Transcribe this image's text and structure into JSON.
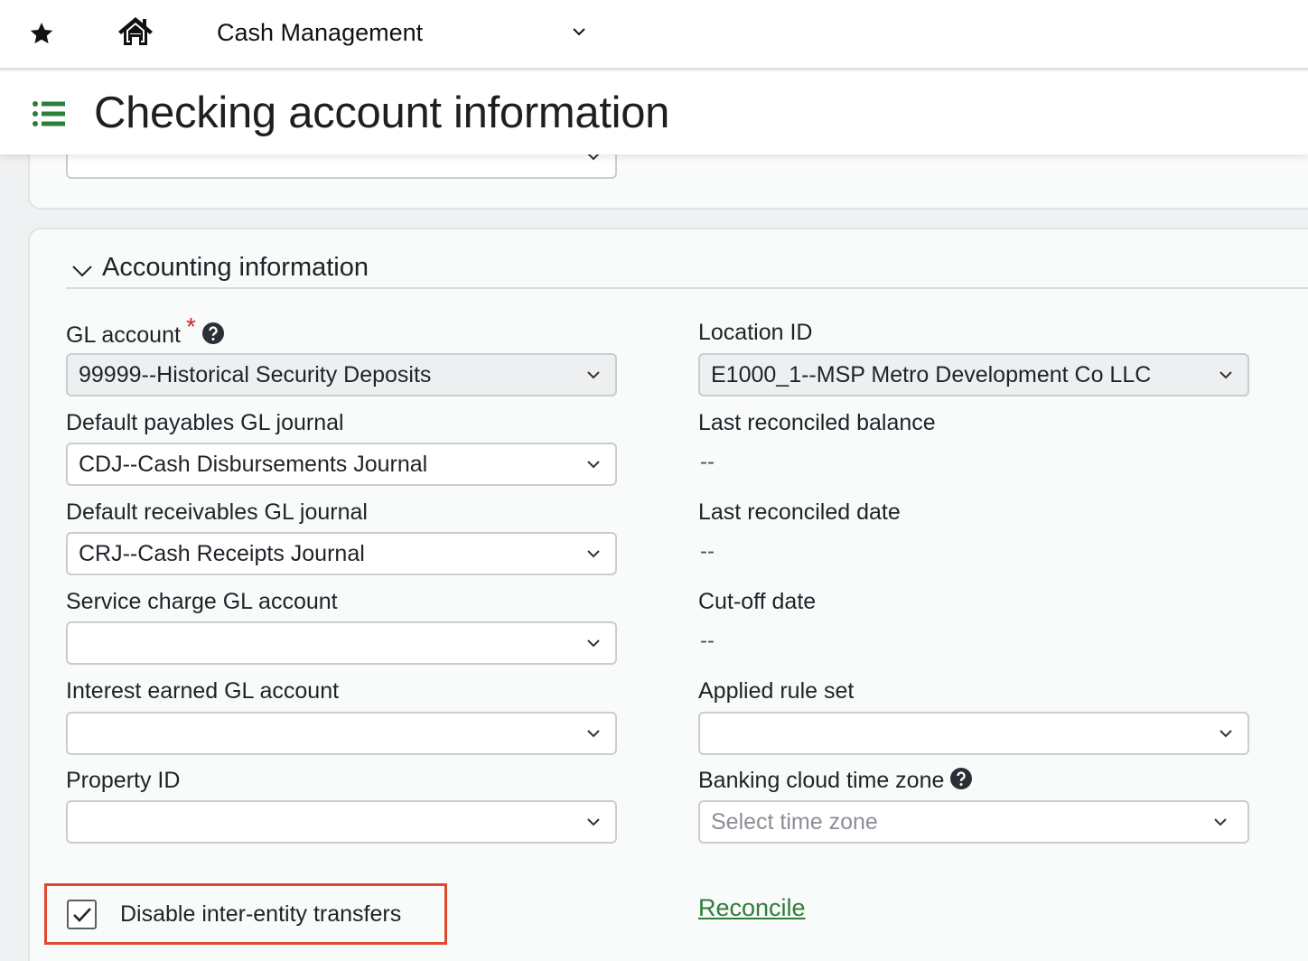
{
  "topbar": {
    "module": "Cash Management"
  },
  "page": {
    "title": "Checking account information"
  },
  "section": {
    "title": "Accounting information"
  },
  "left_fields": [
    {
      "label": "GL account",
      "value": "99999--Historical Security Deposits",
      "required": true,
      "help": true,
      "disabled": true
    },
    {
      "label": "Default payables GL journal",
      "value": "CDJ--Cash Disbursements Journal"
    },
    {
      "label": "Default receivables GL journal",
      "value": "CRJ--Cash Receipts Journal"
    },
    {
      "label": "Service charge GL account",
      "value": ""
    },
    {
      "label": "Interest earned GL account",
      "value": ""
    },
    {
      "label": "Property ID",
      "value": ""
    }
  ],
  "right_fields": {
    "location_label": "Location ID",
    "location_value": "E1000_1--MSP Metro Development Co LLC",
    "last_balance_label": "Last reconciled balance",
    "last_balance_value": "--",
    "last_date_label": "Last reconciled date",
    "last_date_value": "--",
    "cutoff_label": "Cut-off date",
    "cutoff_value": "--",
    "ruleset_label": "Applied rule set",
    "ruleset_value": "",
    "timezone_label": "Banking cloud time zone",
    "timezone_placeholder": "Select time zone"
  },
  "checkbox": {
    "label": "Disable inter-entity transfers",
    "checked": true
  },
  "reconcile_link": "Reconcile",
  "colors": {
    "accent_green": "#2f7d3a",
    "required_red": "#c8262b",
    "highlight_red": "#e0482f"
  }
}
